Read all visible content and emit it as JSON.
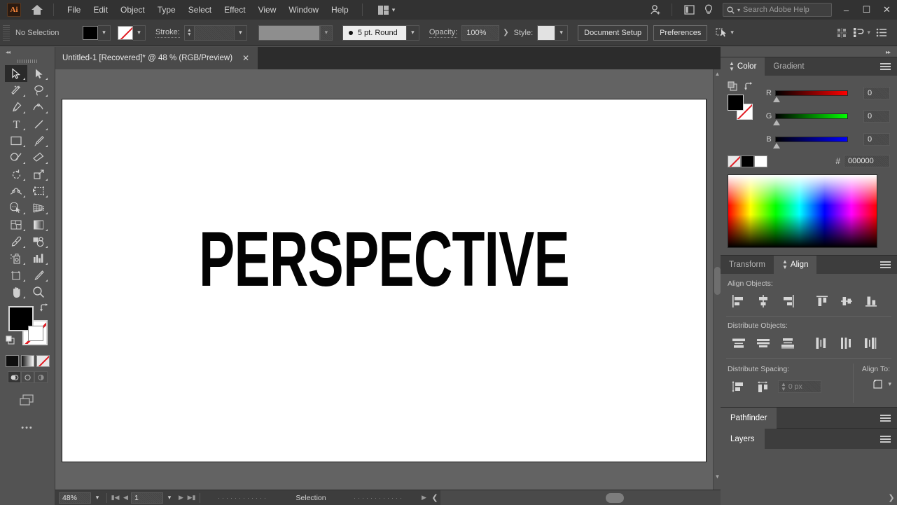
{
  "app": {
    "name": "Ai",
    "menus": [
      "File",
      "Edit",
      "Object",
      "Type",
      "Select",
      "Effect",
      "View",
      "Window",
      "Help"
    ],
    "search_placeholder": "Search Adobe Help",
    "window_minimize": "–",
    "window_maximize": "☐",
    "window_close": "✕"
  },
  "control_bar": {
    "selection_state": "No Selection",
    "fill_color": "#000000",
    "stroke_swatch": "none",
    "stroke_label": "Stroke:",
    "stroke_weight": "",
    "brush_profile": "5 pt. Round",
    "opacity_label": "Opacity:",
    "opacity_value": "100%",
    "style_label": "Style:",
    "document_setup": "Document Setup",
    "preferences": "Preferences"
  },
  "tab": {
    "title": "Untitled-1 [Recovered]* @ 48 % (RGB/Preview)",
    "close": "✕"
  },
  "toolbar": {
    "tools": [
      "selection-tool",
      "direct-selection-tool",
      "magic-wand-tool",
      "lasso-tool",
      "pen-tool",
      "curvature-tool",
      "type-tool",
      "line-segment-tool",
      "rectangle-tool",
      "paintbrush-tool",
      "shaper-tool",
      "eraser-tool",
      "rotate-tool",
      "scale-tool",
      "width-tool",
      "free-transform-tool",
      "shape-builder-tool",
      "perspective-grid-tool",
      "mesh-tool",
      "gradient-tool",
      "eyedropper-tool",
      "blend-tool",
      "symbol-sprayer-tool",
      "column-graph-tool",
      "artboard-tool",
      "slice-tool",
      "hand-tool",
      "zoom-tool"
    ],
    "fill_color": "#000000",
    "stroke_color": "none",
    "color_modes": [
      "color-mode-black",
      "gradient-mode",
      "none-mode"
    ],
    "draw_modes": [
      "draw-normal",
      "draw-behind",
      "draw-inside"
    ],
    "more_tools": "•••"
  },
  "canvas": {
    "artwork_text": "PERSPECTIVE",
    "artboard_color": "#ffffff",
    "background_color": "#636363"
  },
  "status_bar": {
    "zoom": "48%",
    "page": "1",
    "status": "Selection"
  },
  "panels": {
    "color": {
      "tabs": [
        "Color",
        "Gradient"
      ],
      "active_tab": "Color",
      "channels": [
        {
          "letter": "R",
          "value": "0"
        },
        {
          "letter": "G",
          "value": "0"
        },
        {
          "letter": "B",
          "value": "0"
        }
      ],
      "hex_symbol": "#",
      "hex_value": "000000"
    },
    "align": {
      "tabs": [
        "Transform",
        "Align"
      ],
      "active_tab": "Align",
      "align_objects_label": "Align Objects:",
      "align_objects": [
        "align-left-icon",
        "align-horizontal-center-icon",
        "align-right-icon",
        "align-top-icon",
        "align-vertical-center-icon",
        "align-bottom-icon"
      ],
      "distribute_objects_label": "Distribute Objects:",
      "distribute_objects": [
        "distribute-vertical-top-icon",
        "distribute-vertical-center-icon",
        "distribute-vertical-bottom-icon",
        "distribute-horizontal-left-icon",
        "distribute-horizontal-center-icon",
        "distribute-horizontal-right-icon"
      ],
      "distribute_spacing_label": "Distribute Spacing:",
      "spacing_value": "0 px",
      "align_to_label": "Align To:"
    },
    "pathfinder": {
      "title": "Pathfinder"
    },
    "layers": {
      "title": "Layers"
    }
  }
}
